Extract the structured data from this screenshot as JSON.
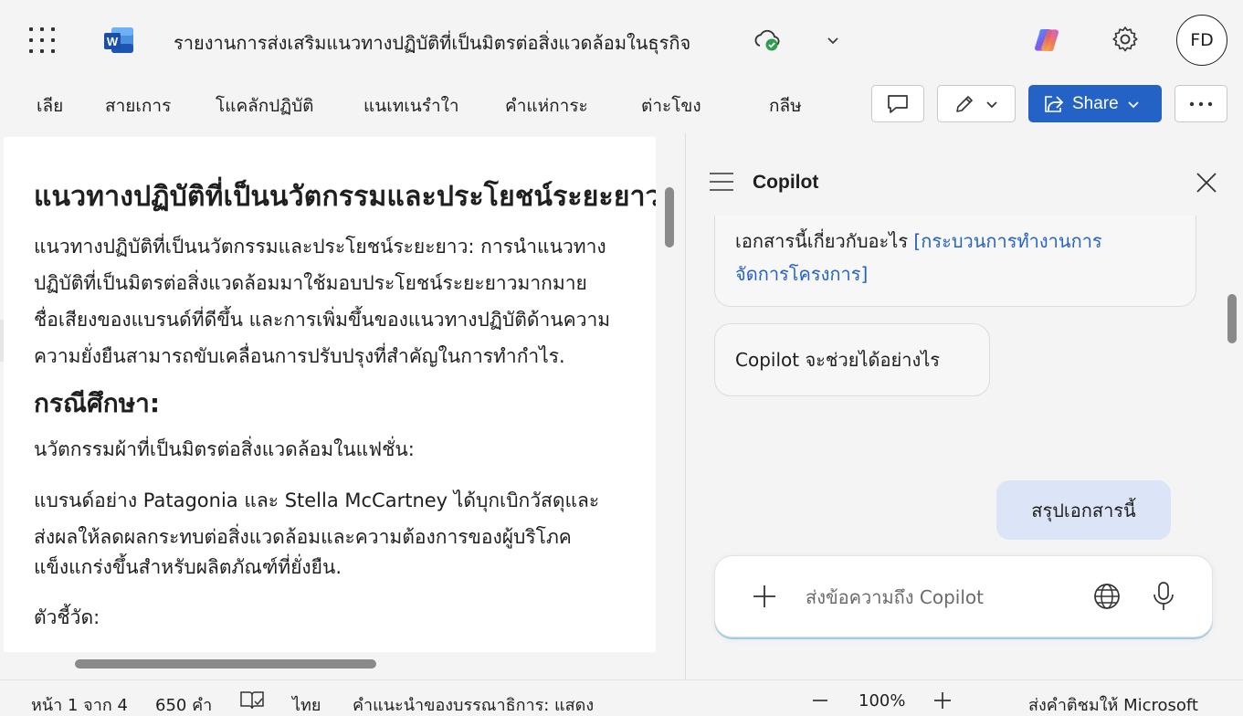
{
  "titlebar": {
    "app_icon": "word-logo",
    "document_title": "รายงานการส่งเสริมแนวทางปฏิบัติที่เป็นมิตรต่อสิ่งแวดล้อมในธุรกิจ",
    "user_initials": "FD"
  },
  "ribbon": {
    "tabs": [
      "เลีย",
      "สายเการ",
      "โแคลักปฏิบัติ",
      "แนเทเนรำใา",
      "คำแห่การะ",
      "ต่าะโขง",
      "กลีษ"
    ],
    "share_label": "Share"
  },
  "document": {
    "heading1": "แนวทางปฏิบัติที่เป็นนวัตกรรมและประโยชน์ระยะยาว",
    "para1": [
      "แนวทางปฏิบัติที่เป็นนวัตกรรมและประโยชน์ระยะยาว: การนำแนวทาง",
      "ปฏิบัติที่เป็นมิตรต่อสิ่งแวดล้อมมาใช้มอบประโยชน์ระยะยาวมากมาย",
      "ชื่อเสียงของแบรนด์ที่ดีขึ้น และการเพิ่มขึ้นของแนวทางปฏิบัติด้านความ",
      "ความยั่งยืนสามารถขับเคลื่อนการปรับปรุงที่สำคัญในการทำกำไร."
    ],
    "heading2": "กรณีศึกษา:",
    "subheading": "นวัตกรรมผ้าที่เป็นมิตรต่อสิ่งแวดล้อมในแฟชั่น:",
    "para2": [
      "แบรนด์อย่าง Patagonia และ Stella McCartney ได้บุกเบิกวัสดุและ",
      "ส่งผลให้ลดผลกระทบต่อสิ่งแวดล้อมและความต้องการของผู้บริโภค",
      "แข็งแกร่งขึ้นสำหรับผลิตภัณฑ์ที่ยั่งยืน."
    ],
    "metrics_label": "ตัวชี้วัด:"
  },
  "copilot": {
    "title": "Copilot",
    "suggestion1_text": "เอกสารนี้เกี่ยวกับอะไร ",
    "suggestion1_link_line1": "[กระบวนการทำงานการ",
    "suggestion1_link_line2": "จัดการโครงการ]",
    "suggestion2": "Copilot จะช่วยได้อย่างไร",
    "user_message": "สรุปเอกสารนี้",
    "composer_placeholder": "ส่งข้อความถึง Copilot"
  },
  "statusbar": {
    "page_info": "หน้า 1 จาก 4",
    "word_count": "650 คำ",
    "language": "ไทย",
    "editor_suggestions": "คำแนะนำของบรรณาธิการ: แสดง",
    "zoom": "100%",
    "feedback": "ส่งคำติชมให้ Microsoft"
  },
  "colors": {
    "accent": "#2463c5",
    "user_bubble": "#dce5f7",
    "background": "#f4f4f4"
  }
}
